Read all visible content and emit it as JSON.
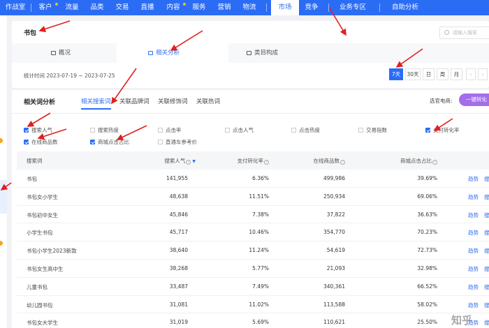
{
  "nav": {
    "items": [
      "作战室",
      "客户",
      "流量",
      "品类",
      "交易",
      "直播",
      "内容",
      "服务",
      "营销",
      "物流",
      "市场",
      "竞争",
      "业务专区",
      "自助分析"
    ],
    "active": "市场"
  },
  "header": {
    "title": "书包",
    "search_placeholder": "请输入搜索",
    "tabs": [
      "概况",
      "相关分析",
      "类目构成"
    ],
    "stat_time": "统计时间 2023-07-19 ~ 2023-07-25",
    "periods": [
      "7天",
      "30天",
      "日",
      "周",
      "月"
    ],
    "period_nav": [
      "‹",
      "›"
    ]
  },
  "analysis": {
    "title": "相关词分析",
    "subtabs": [
      "相关搜索词",
      "关联品牌词",
      "关联修饰词",
      "关联热词"
    ],
    "shop_label": "选官电商:",
    "convert_button": "一键转化",
    "metrics": [
      {
        "label": "搜索人气",
        "checked": true
      },
      {
        "label": "搜索热度",
        "checked": false
      },
      {
        "label": "点击率",
        "checked": false
      },
      {
        "label": "点击人气",
        "checked": false
      },
      {
        "label": "点击热度",
        "checked": false
      },
      {
        "label": "交易指数",
        "checked": false
      },
      {
        "label": "支付转化率",
        "checked": true
      },
      {
        "label": "在线商品数",
        "checked": true
      },
      {
        "label": "商城点击占比",
        "checked": true
      },
      {
        "label": "直通车参考价",
        "checked": false
      }
    ]
  },
  "table": {
    "headers": [
      "搜索词",
      "搜索人气",
      "支付转化率",
      "在线商品数",
      "商城点击占比"
    ],
    "rows": [
      {
        "kw": "书包",
        "pop": "141,955",
        "conv": "6.36%",
        "goods": "499,986",
        "share": "39.69%"
      },
      {
        "kw": "书包女小学生",
        "pop": "48,638",
        "conv": "11.51%",
        "goods": "250,934",
        "share": "69.06%"
      },
      {
        "kw": "书包初中女生",
        "pop": "45,846",
        "conv": "7.38%",
        "goods": "37,822",
        "share": "36.63%"
      },
      {
        "kw": "小学生书包",
        "pop": "45,717",
        "conv": "10.46%",
        "goods": "354,770",
        "share": "70.23%"
      },
      {
        "kw": "书包小学生2023新款",
        "pop": "38,640",
        "conv": "11.24%",
        "goods": "54,619",
        "share": "72.73%"
      },
      {
        "kw": "书包女生高中生",
        "pop": "38,268",
        "conv": "5.77%",
        "goods": "21,093",
        "share": "32.98%"
      },
      {
        "kw": "儿童书包",
        "pop": "33,487",
        "conv": "7.49%",
        "goods": "340,361",
        "share": "66.52%"
      },
      {
        "kw": "幼儿园书包",
        "pop": "31,081",
        "conv": "11.02%",
        "goods": "113,588",
        "share": "58.02%"
      },
      {
        "kw": "书包女大学生",
        "pop": "31,019",
        "conv": "5.69%",
        "goods": "110,621",
        "share": "25.50%"
      }
    ],
    "trend_label": "趋势",
    "more_label": "搜"
  },
  "watermark": "知乎",
  "colors": {
    "brand": "#2b6cf5",
    "accent": "#a46ee8",
    "arrow": "#e02020"
  }
}
